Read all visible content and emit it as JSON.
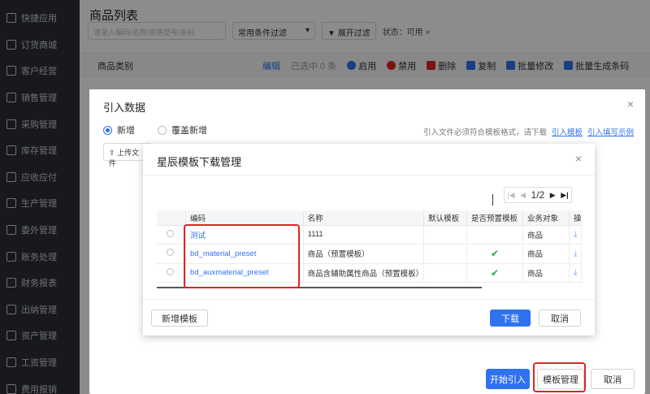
{
  "sidebar": {
    "items": [
      {
        "label": "快捷应用",
        "icon": "lightning-icon"
      },
      {
        "label": "订货商城",
        "icon": "shop-icon"
      },
      {
        "label": "客户经营",
        "icon": "user-icon"
      },
      {
        "label": "销售管理",
        "icon": "chart-icon"
      },
      {
        "label": "采购管理",
        "icon": "cart-icon"
      },
      {
        "label": "库存管理",
        "icon": "box-icon"
      },
      {
        "label": "应收应付",
        "icon": "money-icon"
      },
      {
        "label": "生产管理",
        "icon": "factory-icon"
      },
      {
        "label": "委外管理",
        "icon": "outsource-icon"
      },
      {
        "label": "账务处理",
        "icon": "ledger-icon"
      },
      {
        "label": "财务报表",
        "icon": "report-icon"
      },
      {
        "label": "出纳管理",
        "icon": "cashier-icon"
      },
      {
        "label": "资产管理",
        "icon": "asset-icon"
      },
      {
        "label": "工资管理",
        "icon": "salary-icon"
      },
      {
        "label": "费用报销",
        "icon": "expense-icon"
      }
    ]
  },
  "page": {
    "title": "商品列表",
    "search_placeholder": "请录入编码/名称/规格型号/条码",
    "filter_select": "常用条件过滤",
    "expand_filter": "展开过滤",
    "status": "状态：可用",
    "category_label": "商品类别",
    "edit": "编辑",
    "selected": "已选中 0 条",
    "toolbar": {
      "enable": "启用",
      "disable": "禁用",
      "delete": "删除",
      "copy": "复制",
      "batch_edit": "批量修改",
      "batch_barcode": "批量生成条码"
    }
  },
  "import_dialog": {
    "title": "引入数据",
    "radio_new": "新增",
    "radio_overwrite": "覆盖新增",
    "hint": "引入文件必须符合模板格式，请下载",
    "hint_link_template": "引入模板",
    "hint_link_example": "引入填写示例",
    "upload": "上传文件",
    "start_import": "开始引入",
    "template_manage": "模板管理",
    "cancel": "取消"
  },
  "template_dialog": {
    "title": "星辰模板下载管理",
    "pager": {
      "current": "1/2"
    },
    "columns": [
      "编码",
      "名称",
      "默认模板",
      "是否预置模板",
      "业务对象",
      "操"
    ],
    "rows": [
      {
        "code": "测试",
        "name": "1111",
        "default": "",
        "preset": "",
        "object": "商品"
      },
      {
        "code": "bd_material_preset",
        "name": "商品（预置模板）",
        "default": "",
        "preset": "✔",
        "object": "商品"
      },
      {
        "code": "bd_auxmaterial_preset",
        "name": "商品含辅助属性商品（预置模板）",
        "default": "",
        "preset": "✔",
        "object": "商品"
      }
    ],
    "new_template": "新增模板",
    "download": "下载",
    "cancel": "取消"
  },
  "colors": {
    "primary": "#2f72f0",
    "sidebar": "#2b2f3a",
    "highlight": "#e02424",
    "check": "#27a844"
  }
}
